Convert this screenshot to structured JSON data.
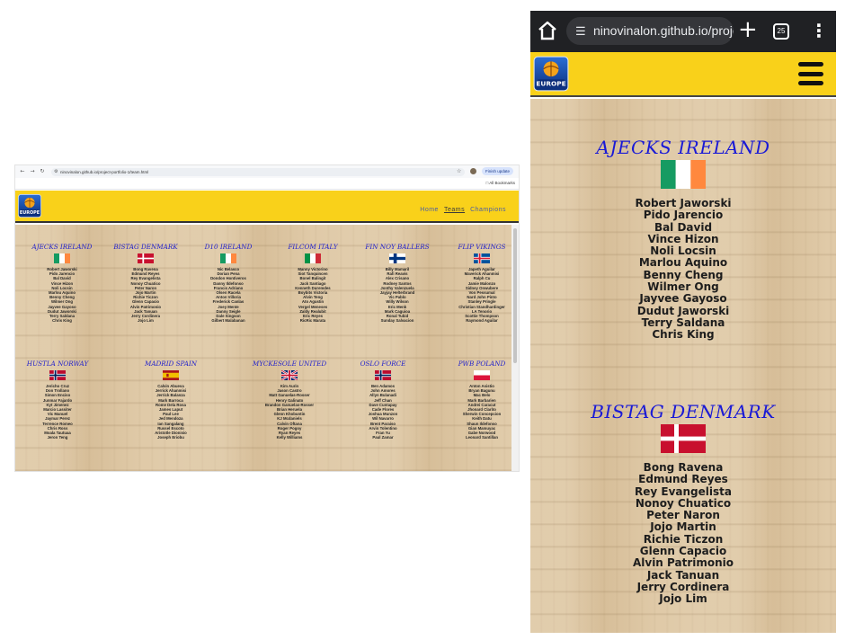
{
  "desktop": {
    "url": "ninovinalon.github.io/project-portfolio-1/team.html",
    "finish_update": "Finish update",
    "bookmarks_label": "All Bookmarks",
    "nav": [
      "Home",
      "Teams",
      "Champions"
    ],
    "teams": [
      {
        "name": "AJECKS IRELAND",
        "flag": "ireland",
        "players": [
          "Robert Jaworski",
          "Pido Jarencio",
          "Bal David",
          "Vince Hizon",
          "Noli Locsin",
          "Marlou Aquino",
          "Benny Cheng",
          "Wilmer Ong",
          "Jayvee Gayoso",
          "Dudut Jaworski",
          "Terry Saldana",
          "Chris King"
        ]
      },
      {
        "name": "BISTAG DENMARK",
        "flag": "denmark",
        "players": [
          "Bong Ravena",
          "Edmund Reyes",
          "Rey Evangelista",
          "Nonoy Chuatico",
          "Peter Naron",
          "Jojo Martin",
          "Richie Ticzon",
          "Glenn Capacio",
          "Alvin Patrimonio",
          "Jack Tanuan",
          "Jerry Cordinera",
          "Jojo Lim"
        ]
      },
      {
        "name": "D10 IRELAND",
        "flag": "ireland",
        "players": [
          "Nic Belasco",
          "Dorian Pena",
          "Dondon Hontiveros",
          "Danny Ildefonso",
          "Francis Adriano",
          "Olsen Racela",
          "Anton Villoria",
          "Frederick Canlas",
          "Joey Mente",
          "Danny Seigle",
          "Dale Singson",
          "Gilbert Malabanan"
        ]
      },
      {
        "name": "FILCOM ITALY",
        "flag": "italy",
        "players": [
          "Manny Victorino",
          "Siot Tanquincen",
          "Bonel Balingit",
          "Jack Santiago",
          "Kenneth Duremdes",
          "Boybits Victoria",
          "Alvin Teng",
          "Ato Agustin",
          "Vergel Meneses",
          "Zaldy Realubit",
          "Eric Reyes",
          "RicRic Marata"
        ]
      },
      {
        "name": "FIN NOY BALLERS",
        "flag": "finland",
        "players": [
          "Billy Mamaril",
          "Rafi Reavis",
          "Alex Crisano",
          "Rodney Santos",
          "Jonthy Valenzuela",
          "Jayjay Helterbrand",
          "Vic Pablo",
          "Willy Wilson",
          "Eric Menk",
          "Mark Caguioa",
          "Ronal Tubid",
          "Sunday Salvacion"
        ]
      },
      {
        "name": "FLIP VIKINGS",
        "flag": "iceland",
        "players": [
          "Japeth Aguilar",
          "Maverick Ahanmisi",
          "Ralph Cu",
          "Jamie Malonzo",
          "Sidney Onwubere",
          "Von Pessumal",
          "Nard John Pinto",
          "Stanley Pringle",
          "Christian Standhardinger",
          "LA Tenorio",
          "Scottie Thompson",
          "Raymond Aguilar"
        ]
      },
      {
        "name": "HUSTLA NORWAY",
        "flag": "norway",
        "players": [
          "Jericho Cruz",
          "Don Trollano",
          "Simon Enciso",
          "Junmar Fajardo",
          "Kyt Jimenez",
          "Marcio Lassiter",
          "Vic Manuel",
          "Jaymar Perez",
          "Terrence Romeo",
          "Chris Ross",
          "Moala Tautuaa",
          "Jeron Teng"
        ]
      },
      {
        "name": "MADRID SPAIN",
        "flag": "spain",
        "players": [
          "Calvin Abueva",
          "Jerrick Ahanmisi",
          "Jerrick Balanza",
          "Mark Barroca",
          "Rome Dela Rosa",
          "James Laput",
          "Paul Lee",
          "Jed Mendoza",
          "Ian Sangalang",
          "Russel Escoto",
          "Aristotle Dionisio",
          "Joseph Eriobu"
        ]
      },
      {
        "name": "MYCKESOLE UNITED",
        "flag": "uk",
        "players": [
          "Kim Aurin",
          "Jason Castro",
          "Matt Ganuelas-Rosser",
          "Henry Galinato",
          "Brandon Ganuelas-Rosser",
          "Brian Heruela",
          "Glenn Khobuntin",
          "KJ Mcdaniels",
          "Calvin Oftana",
          "Roger Pogoy",
          "Ryan Reyes",
          "Kelly Williams"
        ]
      },
      {
        "name": "OSLO FORCE",
        "flag": "norway",
        "players": [
          "Ben Adamos",
          "John Amores",
          "Allyn Bulanadi",
          "Jeff Chan",
          "Dave Cuntapay",
          "Cade Flores",
          "Joshua Munzon",
          "Wil Navarro",
          "Brent Paraiso",
          "Arvin Tolentino",
          "Fran Yu",
          "Paul Zamar"
        ]
      },
      {
        "name": "PWB POLAND",
        "flag": "poland",
        "players": [
          "Anton Asistio",
          "Bryan Bagunu",
          "Mac Belo",
          "Mark Barbarien",
          "Andrei Caracut",
          "Jhonard Clarito",
          "Sherwin Concepcion",
          "Keith Datu",
          "Shaun Ildefonso",
          "Gian Mamuyac",
          "Gabe Norwood",
          "Leonard Santillan"
        ]
      }
    ]
  },
  "mobile": {
    "url": "ninovinalon.github.io/projec",
    "tab_count": "25",
    "teams": [
      {
        "name": "AJECKS IRELAND",
        "flag": "ireland",
        "players": [
          "Robert Jaworski",
          "Pido Jarencio",
          "Bal David",
          "Vince Hizon",
          "Noli Locsin",
          "Marlou Aquino",
          "Benny Cheng",
          "Wilmer Ong",
          "Jayvee Gayoso",
          "Dudut Jaworski",
          "Terry Saldana",
          "Chris King"
        ]
      },
      {
        "name": "BISTAG DENMARK",
        "flag": "denmark",
        "players": [
          "Bong Ravena",
          "Edmund Reyes",
          "Rey Evangelista",
          "Nonoy Chuatico",
          "Peter Naron",
          "Jojo Martin",
          "Richie Ticzon",
          "Glenn Capacio",
          "Alvin Patrimonio",
          "Jack Tanuan",
          "Jerry Cordinera",
          "Jojo Lim"
        ]
      }
    ]
  },
  "logo_text": "EUROPE",
  "colors": {
    "header_yellow": "#f9d11a",
    "team_blue": "#2222cc",
    "nav_blue": "#4a5da6"
  }
}
